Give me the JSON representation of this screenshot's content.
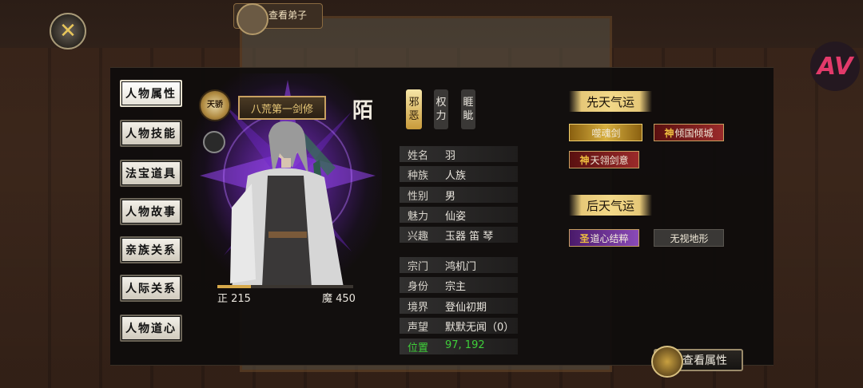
{
  "header": {
    "tab_title": "查看弟子",
    "close_label": "✕"
  },
  "sidebar": {
    "items": [
      {
        "label": "人物属性",
        "active": true
      },
      {
        "label": "人物技能"
      },
      {
        "label": "法宝道具"
      },
      {
        "label": "人物故事"
      },
      {
        "label": "亲族关系"
      },
      {
        "label": "人际关系"
      },
      {
        "label": "人物道心"
      }
    ]
  },
  "character": {
    "rank_badge": "天骄",
    "title": "八荒第一剑修",
    "surname": "陌",
    "righteous_label": "正 215",
    "demonic_label": "魔 450",
    "righteous_value": 215,
    "demonic_value": 450
  },
  "tags": [
    "邪恶",
    "权力",
    "睚眦"
  ],
  "info": {
    "rows": [
      {
        "label": "姓名",
        "value": "羽"
      },
      {
        "label": "种族",
        "value": "人族"
      },
      {
        "label": "性别",
        "value": "男"
      },
      {
        "label": "魅力",
        "value": "仙姿"
      },
      {
        "label": "兴趣",
        "value": "玉器  笛  琴"
      },
      {
        "label": "宗门",
        "value": "鸿机门"
      },
      {
        "label": "身份",
        "value": "宗主"
      },
      {
        "label": "境界",
        "value": "登仙初期"
      },
      {
        "label": "声望",
        "value": "默默无闻（0）"
      },
      {
        "label": "位置",
        "value": "97, 192"
      }
    ]
  },
  "fortune": {
    "innate_heading": "先天气运",
    "innate": [
      {
        "rank": "",
        "label": "噬魂剑",
        "style": "gold"
      },
      {
        "rank": "神",
        "label": "倾国倾城",
        "style": "red"
      },
      {
        "rank": "神",
        "label": "天翎剑意",
        "style": "red"
      }
    ],
    "acquired_heading": "后天气运",
    "acquired": [
      {
        "rank": "圣",
        "label": "道心结粹",
        "style": "purple"
      },
      {
        "rank": "",
        "label": "无视地形",
        "style": "gray"
      }
    ]
  },
  "actions": {
    "view_attributes": "查看属性"
  },
  "colors": {
    "gold": "#e6c878",
    "green": "#3fcf3a",
    "aura": "#a03cff"
  }
}
